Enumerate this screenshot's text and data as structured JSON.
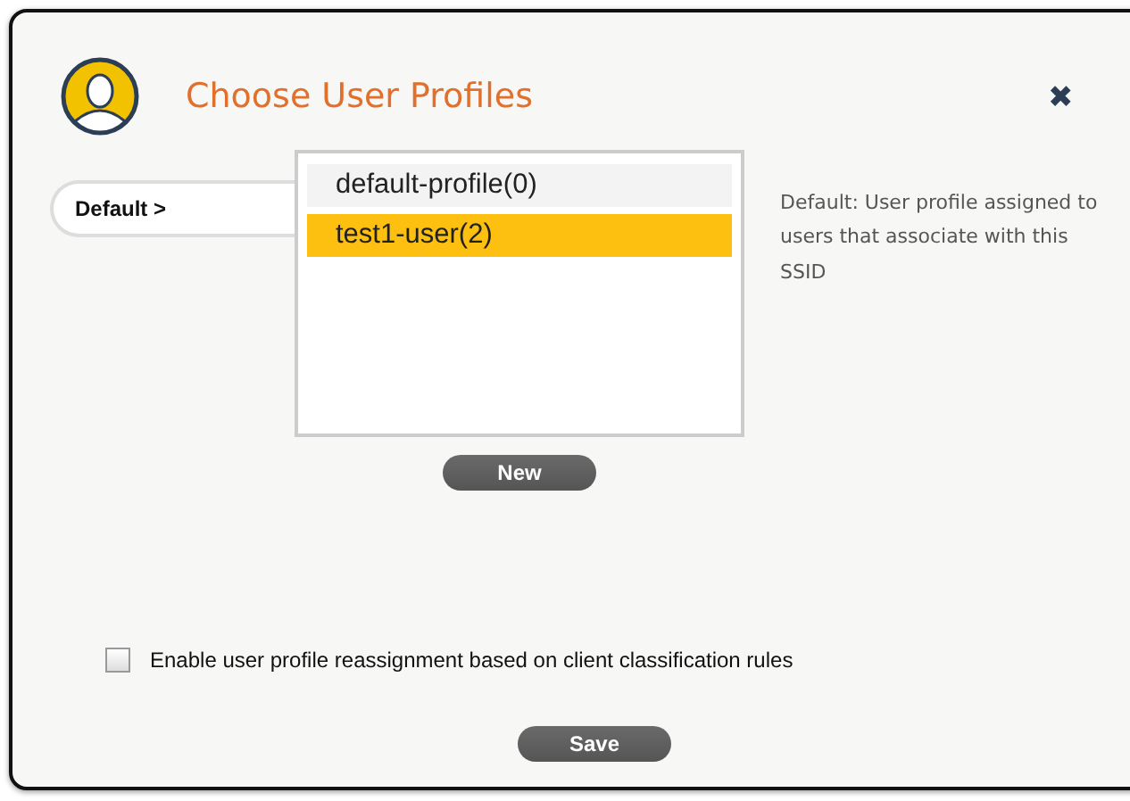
{
  "dialog": {
    "title": "Choose User Profiles",
    "close": "✖"
  },
  "ssid_tab": {
    "label": "Default >"
  },
  "profiles": [
    {
      "label": "default-profile(0)",
      "selected": false
    },
    {
      "label": "test1-user(2)",
      "selected": true
    }
  ],
  "description": "Default: User profile assigned to users that associate with this SSID",
  "new_button": "New",
  "reassignment": {
    "label": "Enable user profile reassignment based on client classification rules",
    "checked": false
  },
  "save_button": "Save"
}
